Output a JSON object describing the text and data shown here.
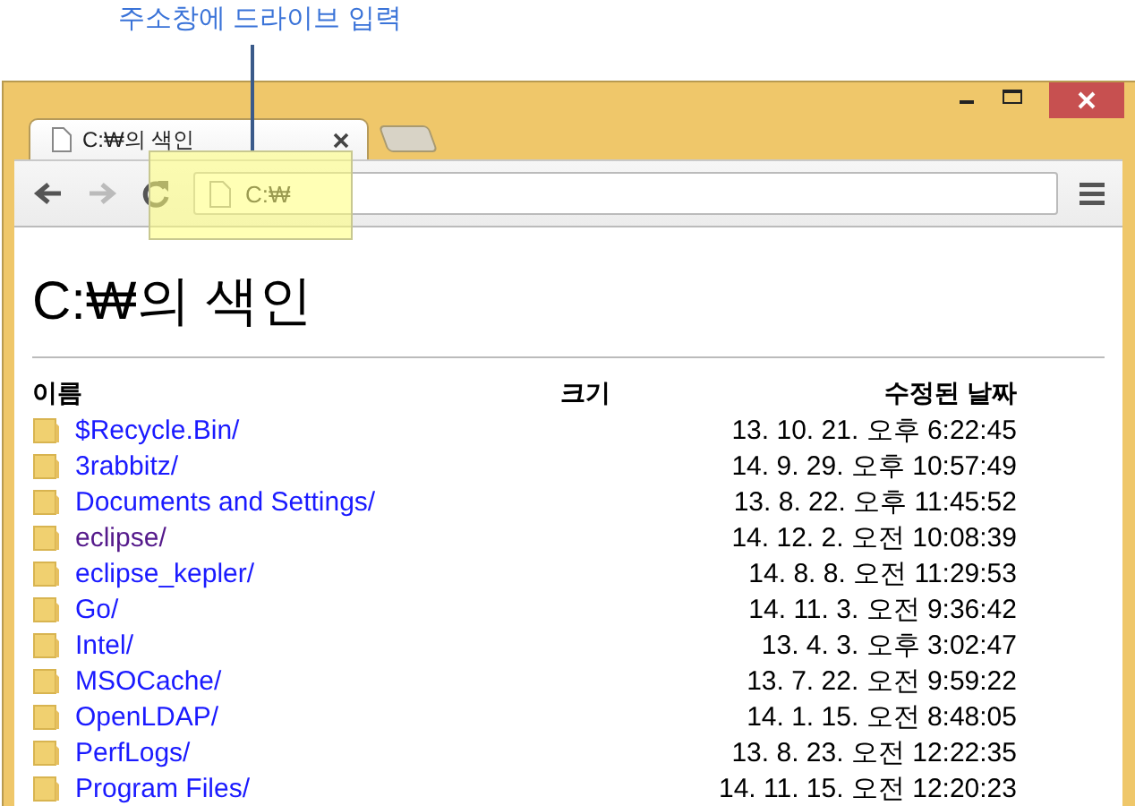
{
  "annotation": {
    "text": "주소창에 드라이브 입력"
  },
  "tabs": [
    {
      "title": "C:₩의 색인",
      "selected": true
    }
  ],
  "toolbar": {
    "back": {
      "disabled": false
    },
    "forward": {
      "disabled": true
    },
    "address": {
      "value": "C:₩"
    }
  },
  "page": {
    "heading": "C:₩의 색인",
    "columns": [
      "이름",
      "크기",
      "수정된 날짜"
    ],
    "rows": [
      {
        "name": "$Recycle.Bin/",
        "modified": "13. 10. 21. 오후 6:22:45",
        "visited": false
      },
      {
        "name": "3rabbitz/",
        "modified": "14. 9. 29. 오후 10:57:49",
        "visited": false
      },
      {
        "name": "Documents and Settings/",
        "modified": "13. 8. 22. 오후 11:45:52",
        "visited": false
      },
      {
        "name": "eclipse/",
        "modified": "14. 12. 2. 오전 10:08:39",
        "visited": true
      },
      {
        "name": "eclipse_kepler/",
        "modified": "14. 8. 8. 오전 11:29:53",
        "visited": false
      },
      {
        "name": "Go/",
        "modified": "14. 11. 3. 오전 9:36:42",
        "visited": false
      },
      {
        "name": "Intel/",
        "modified": "13. 4. 3. 오후 3:02:47",
        "visited": false
      },
      {
        "name": "MSOCache/",
        "modified": "13. 7. 22. 오전 9:59:22",
        "visited": false
      },
      {
        "name": "OpenLDAP/",
        "modified": "14. 1. 15. 오전 8:48:05",
        "visited": false
      },
      {
        "name": "PerfLogs/",
        "modified": "13. 8. 23. 오전 12:22:35",
        "visited": false
      },
      {
        "name": "Program Files/",
        "modified": "14. 11. 15. 오전 12:20:23",
        "visited": false
      }
    ]
  }
}
